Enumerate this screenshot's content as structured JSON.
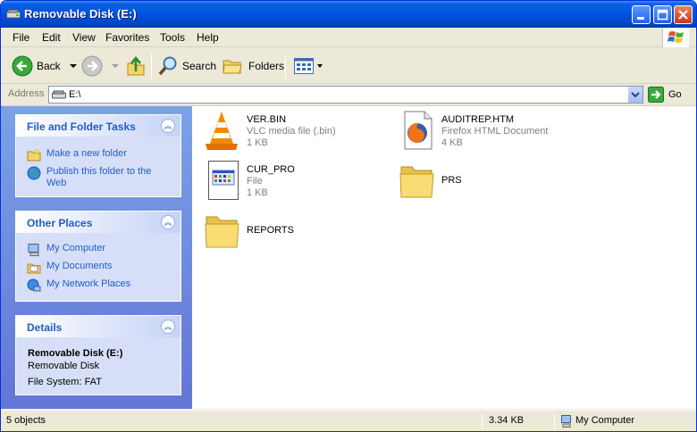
{
  "window": {
    "title": "Removable Disk (E:)"
  },
  "menu": [
    "File",
    "Edit",
    "View",
    "Favorites",
    "Tools",
    "Help"
  ],
  "toolbar": {
    "back": "Back",
    "search": "Search",
    "folders": "Folders"
  },
  "address": {
    "label": "Address",
    "value": "E:\\",
    "go": "Go"
  },
  "tasks": {
    "title": "File and Folder Tasks",
    "items": [
      "Make a new folder",
      "Publish this folder to the Web"
    ]
  },
  "places": {
    "title": "Other Places",
    "items": [
      "My Computer",
      "My Documents",
      "My Network Places"
    ]
  },
  "details": {
    "title": "Details",
    "name": "Removable Disk (E:)",
    "type": "Removable Disk",
    "fs": "File System: FAT"
  },
  "files": [
    {
      "name": "VER.BIN",
      "type": "VLC media file (.bin)",
      "size": "1 KB",
      "icon": "vlc-cone-icon"
    },
    {
      "name": "AUDITREP.HTM",
      "type": "Firefox HTML Document",
      "size": "4 KB",
      "icon": "firefox-icon"
    },
    {
      "name": "CUR_PRO",
      "type": "File",
      "size": "1 KB",
      "icon": "generic-file-icon"
    },
    {
      "name": "PRS",
      "icon": "folder-icon"
    },
    {
      "name": "REPORTS",
      "icon": "folder-icon"
    }
  ],
  "status": {
    "objects": "5 objects",
    "size": "3.34 KB",
    "zone": "My Computer"
  },
  "colors": {
    "titlebar": "#0055e5",
    "sidebar": "#7ba2e7",
    "link": "#215dc6"
  }
}
